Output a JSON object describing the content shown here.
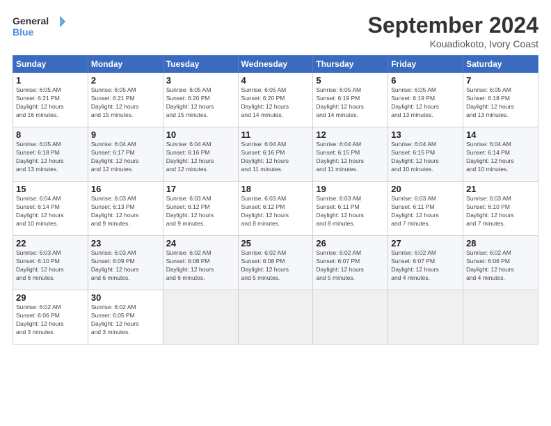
{
  "logo": {
    "line1": "General",
    "line2": "Blue"
  },
  "title": "September 2024",
  "location": "Kouadiokoto, Ivory Coast",
  "days_of_week": [
    "Sunday",
    "Monday",
    "Tuesday",
    "Wednesday",
    "Thursday",
    "Friday",
    "Saturday"
  ],
  "weeks": [
    [
      {
        "day": "1",
        "info": "Sunrise: 6:05 AM\nSunset: 6:21 PM\nDaylight: 12 hours\nand 16 minutes."
      },
      {
        "day": "2",
        "info": "Sunrise: 6:05 AM\nSunset: 6:21 PM\nDaylight: 12 hours\nand 15 minutes."
      },
      {
        "day": "3",
        "info": "Sunrise: 6:05 AM\nSunset: 6:20 PM\nDaylight: 12 hours\nand 15 minutes."
      },
      {
        "day": "4",
        "info": "Sunrise: 6:05 AM\nSunset: 6:20 PM\nDaylight: 12 hours\nand 14 minutes."
      },
      {
        "day": "5",
        "info": "Sunrise: 6:05 AM\nSunset: 6:19 PM\nDaylight: 12 hours\nand 14 minutes."
      },
      {
        "day": "6",
        "info": "Sunrise: 6:05 AM\nSunset: 6:19 PM\nDaylight: 12 hours\nand 13 minutes."
      },
      {
        "day": "7",
        "info": "Sunrise: 6:05 AM\nSunset: 6:18 PM\nDaylight: 12 hours\nand 13 minutes."
      }
    ],
    [
      {
        "day": "8",
        "info": "Sunrise: 6:05 AM\nSunset: 6:18 PM\nDaylight: 12 hours\nand 13 minutes."
      },
      {
        "day": "9",
        "info": "Sunrise: 6:04 AM\nSunset: 6:17 PM\nDaylight: 12 hours\nand 12 minutes."
      },
      {
        "day": "10",
        "info": "Sunrise: 6:04 AM\nSunset: 6:16 PM\nDaylight: 12 hours\nand 12 minutes."
      },
      {
        "day": "11",
        "info": "Sunrise: 6:04 AM\nSunset: 6:16 PM\nDaylight: 12 hours\nand 11 minutes."
      },
      {
        "day": "12",
        "info": "Sunrise: 6:04 AM\nSunset: 6:15 PM\nDaylight: 12 hours\nand 11 minutes."
      },
      {
        "day": "13",
        "info": "Sunrise: 6:04 AM\nSunset: 6:15 PM\nDaylight: 12 hours\nand 10 minutes."
      },
      {
        "day": "14",
        "info": "Sunrise: 6:04 AM\nSunset: 6:14 PM\nDaylight: 12 hours\nand 10 minutes."
      }
    ],
    [
      {
        "day": "15",
        "info": "Sunrise: 6:04 AM\nSunset: 6:14 PM\nDaylight: 12 hours\nand 10 minutes."
      },
      {
        "day": "16",
        "info": "Sunrise: 6:03 AM\nSunset: 6:13 PM\nDaylight: 12 hours\nand 9 minutes."
      },
      {
        "day": "17",
        "info": "Sunrise: 6:03 AM\nSunset: 6:12 PM\nDaylight: 12 hours\nand 9 minutes."
      },
      {
        "day": "18",
        "info": "Sunrise: 6:03 AM\nSunset: 6:12 PM\nDaylight: 12 hours\nand 8 minutes."
      },
      {
        "day": "19",
        "info": "Sunrise: 6:03 AM\nSunset: 6:11 PM\nDaylight: 12 hours\nand 8 minutes."
      },
      {
        "day": "20",
        "info": "Sunrise: 6:03 AM\nSunset: 6:11 PM\nDaylight: 12 hours\nand 7 minutes."
      },
      {
        "day": "21",
        "info": "Sunrise: 6:03 AM\nSunset: 6:10 PM\nDaylight: 12 hours\nand 7 minutes."
      }
    ],
    [
      {
        "day": "22",
        "info": "Sunrise: 6:03 AM\nSunset: 6:10 PM\nDaylight: 12 hours\nand 6 minutes."
      },
      {
        "day": "23",
        "info": "Sunrise: 6:03 AM\nSunset: 6:09 PM\nDaylight: 12 hours\nand 6 minutes."
      },
      {
        "day": "24",
        "info": "Sunrise: 6:02 AM\nSunset: 6:08 PM\nDaylight: 12 hours\nand 6 minutes."
      },
      {
        "day": "25",
        "info": "Sunrise: 6:02 AM\nSunset: 6:08 PM\nDaylight: 12 hours\nand 5 minutes."
      },
      {
        "day": "26",
        "info": "Sunrise: 6:02 AM\nSunset: 6:07 PM\nDaylight: 12 hours\nand 5 minutes."
      },
      {
        "day": "27",
        "info": "Sunrise: 6:02 AM\nSunset: 6:07 PM\nDaylight: 12 hours\nand 4 minutes."
      },
      {
        "day": "28",
        "info": "Sunrise: 6:02 AM\nSunset: 6:06 PM\nDaylight: 12 hours\nand 4 minutes."
      }
    ],
    [
      {
        "day": "29",
        "info": "Sunrise: 6:02 AM\nSunset: 6:06 PM\nDaylight: 12 hours\nand 3 minutes."
      },
      {
        "day": "30",
        "info": "Sunrise: 6:02 AM\nSunset: 6:05 PM\nDaylight: 12 hours\nand 3 minutes."
      },
      {
        "day": "",
        "info": ""
      },
      {
        "day": "",
        "info": ""
      },
      {
        "day": "",
        "info": ""
      },
      {
        "day": "",
        "info": ""
      },
      {
        "day": "",
        "info": ""
      }
    ]
  ]
}
